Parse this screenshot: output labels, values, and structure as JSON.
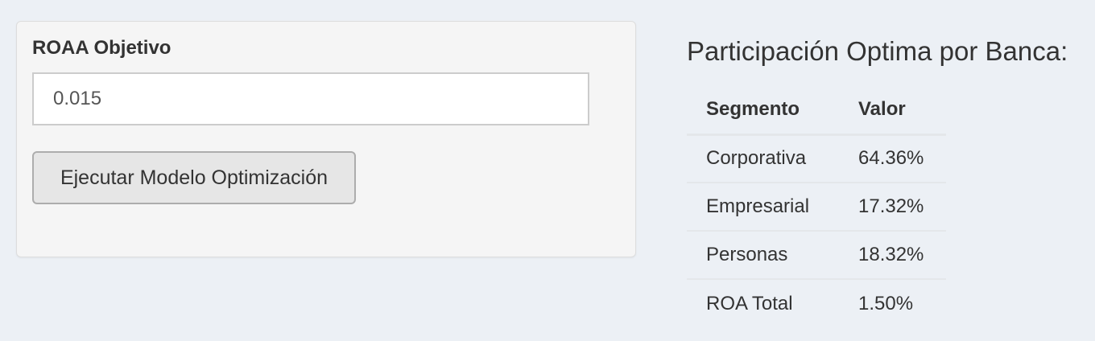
{
  "input_panel": {
    "label": "ROAA Objetivo",
    "input_value": "0.015",
    "button_label": "Ejecutar Modelo Optimización"
  },
  "results": {
    "title": "Participación Optima por Banca:",
    "headers": {
      "segment": "Segmento",
      "value": "Valor"
    },
    "rows": [
      {
        "segment": "Corporativa",
        "value": "64.36%"
      },
      {
        "segment": "Empresarial",
        "value": "17.32%"
      },
      {
        "segment": "Personas",
        "value": "18.32%"
      },
      {
        "segment": "ROA Total",
        "value": "1.50%"
      }
    ]
  },
  "colors": {
    "page_background": "#ecf0f5",
    "panel_background": "#f5f5f5",
    "button_background": "#e6e6e6",
    "text": "#333333"
  }
}
